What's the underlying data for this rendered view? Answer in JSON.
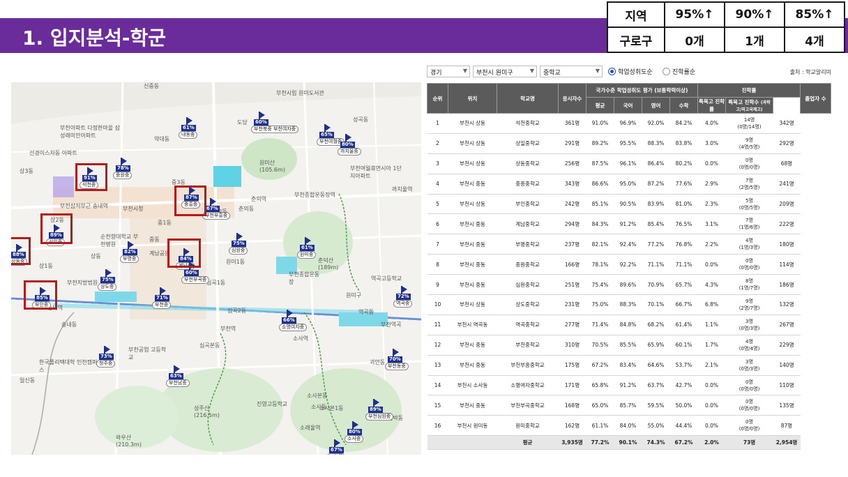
{
  "header": {
    "title": "1. 입지분석-학군"
  },
  "summary": {
    "headers": [
      "지역",
      "95%↑",
      "90%↑",
      "85%↑"
    ],
    "row": [
      "구로구",
      "0개",
      "1개",
      "4개"
    ]
  },
  "filters": {
    "province": "경기",
    "district": "부천시 원미구",
    "level": "중학교",
    "radio_options": [
      "학업성취도순",
      "진학률순"
    ],
    "selected_radio": "학업성취도순",
    "source": "출처 : 학교알리미"
  },
  "table": {
    "headers": {
      "rank": "순위",
      "location": "위치",
      "school": "학교명",
      "applicants": "응시자수",
      "achievement_group": "국가수준 학업성취도 평가 (보통학력이상)",
      "avg": "평균",
      "korean": "국어",
      "english": "영어",
      "math": "수학",
      "advance_group": "진학률",
      "special_rate": "특목고 진학률",
      "special_count": "특목고 진학수",
      "special_count_sub": "(과학고/외고국제고)",
      "graduates": "졸업자 수"
    },
    "rows": [
      {
        "rank": "1",
        "location": "부천시 상동",
        "school": "석천중학교",
        "applicants": "361명",
        "avg": "91.0%",
        "korean": "96.9%",
        "english": "92.0%",
        "math": "84.2%",
        "special_rate": "4.0%",
        "special_count": "14명",
        "special_sub": "(0명/14명)",
        "graduates": "342명"
      },
      {
        "rank": "2",
        "location": "부천시 상동",
        "school": "상일중학교",
        "applicants": "291명",
        "avg": "89.2%",
        "korean": "95.5%",
        "english": "88.3%",
        "math": "83.8%",
        "special_rate": "3.0%",
        "special_count": "9명",
        "special_sub": "(4명/5명)",
        "graduates": "292명"
      },
      {
        "rank": "3",
        "location": "부천시 상동",
        "school": "상동중학교",
        "applicants": "256명",
        "avg": "87.5%",
        "korean": "96.1%",
        "english": "86.4%",
        "math": "80.2%",
        "special_rate": "0.0%",
        "special_count": "0명",
        "special_sub": "(0명/0명)",
        "graduates": "68명"
      },
      {
        "rank": "4",
        "location": "부천시 중동",
        "school": "중흥중학교",
        "applicants": "343명",
        "avg": "86.6%",
        "korean": "95.0%",
        "english": "87.2%",
        "math": "77.6%",
        "special_rate": "2.9%",
        "special_count": "7명",
        "special_sub": "(2명/5명)",
        "graduates": "241명"
      },
      {
        "rank": "5",
        "location": "부천시 상동",
        "school": "부인중학교",
        "applicants": "242명",
        "avg": "85.1%",
        "korean": "90.5%",
        "english": "83.9%",
        "math": "81.0%",
        "special_rate": "2.3%",
        "special_count": "5명",
        "special_sub": "(0명/5명)",
        "graduates": "209명"
      },
      {
        "rank": "6",
        "location": "부천시 중동",
        "school": "계남중학교",
        "applicants": "294명",
        "avg": "84.3%",
        "korean": "91.2%",
        "english": "85.4%",
        "math": "76.5%",
        "special_rate": "3.1%",
        "special_count": "7명",
        "special_sub": "(1명/6명)",
        "graduates": "222명"
      },
      {
        "rank": "7",
        "location": "부천시 중동",
        "school": "부명중학교",
        "applicants": "237명",
        "avg": "82.1%",
        "korean": "92.4%",
        "english": "77.2%",
        "math": "76.8%",
        "special_rate": "2.2%",
        "special_count": "4명",
        "special_sub": "(1명/3명)",
        "graduates": "180명"
      },
      {
        "rank": "8",
        "location": "부천시 중동",
        "school": "중원중학교",
        "applicants": "166명",
        "avg": "78.1%",
        "korean": "92.2%",
        "english": "71.1%",
        "math": "71.1%",
        "special_rate": "0.0%",
        "special_count": "0명",
        "special_sub": "(0명/0명)",
        "graduates": "114명"
      },
      {
        "rank": "9",
        "location": "부천시 중동",
        "school": "심원중학교",
        "applicants": "251명",
        "avg": "75.4%",
        "korean": "89.6%",
        "english": "70.9%",
        "math": "65.7%",
        "special_rate": "4.3%",
        "special_count": "8명",
        "special_sub": "(1명/7명)",
        "graduates": "186명"
      },
      {
        "rank": "10",
        "location": "부천시 상동",
        "school": "상도중학교",
        "applicants": "231명",
        "avg": "75.0%",
        "korean": "88.3%",
        "english": "70.1%",
        "math": "66.7%",
        "special_rate": "6.8%",
        "special_count": "9명",
        "special_sub": "(2명/7명)",
        "graduates": "132명"
      },
      {
        "rank": "11",
        "location": "부천시 역곡동",
        "school": "역곡중학교",
        "applicants": "277명",
        "avg": "71.4%",
        "korean": "84.8%",
        "english": "68.2%",
        "math": "61.4%",
        "special_rate": "1.1%",
        "special_count": "3명",
        "special_sub": "(0명/3명)",
        "graduates": "267명"
      },
      {
        "rank": "12",
        "location": "부천시 중동",
        "school": "부천중학교",
        "applicants": "310명",
        "avg": "70.5%",
        "korean": "85.5%",
        "english": "65.9%",
        "math": "60.1%",
        "special_rate": "1.7%",
        "special_count": "4명",
        "special_sub": "(0명/4명)",
        "graduates": "229명"
      },
      {
        "rank": "13",
        "location": "부천시 중동",
        "school": "부천부흥중학교",
        "applicants": "175명",
        "avg": "67.2%",
        "korean": "83.4%",
        "english": "64.6%",
        "math": "53.7%",
        "special_rate": "2.1%",
        "special_count": "3명",
        "special_sub": "(0명/3명)",
        "graduates": "140명"
      },
      {
        "rank": "14",
        "location": "부천시 소사동",
        "school": "소명여자중학교",
        "applicants": "171명",
        "avg": "65.8%",
        "korean": "91.2%",
        "english": "63.7%",
        "math": "42.7%",
        "special_rate": "0.0%",
        "special_count": "0명",
        "special_sub": "(0명/0명)",
        "graduates": "110명"
      },
      {
        "rank": "15",
        "location": "부천시 중동",
        "school": "부천부곡중학교",
        "applicants": "168명",
        "avg": "65.0%",
        "korean": "85.7%",
        "english": "59.5%",
        "math": "50.0%",
        "special_rate": "0.0%",
        "special_count": "0명",
        "special_sub": "(0명/0명)",
        "graduates": "135명"
      },
      {
        "rank": "16",
        "location": "부천시 원미동",
        "school": "원미중학교",
        "applicants": "162명",
        "avg": "61.1%",
        "korean": "84.0%",
        "english": "55.0%",
        "math": "44.4%",
        "special_rate": "0.0%",
        "special_count": "0명",
        "special_sub": "(0명/0명)",
        "graduates": "87명"
      }
    ],
    "average_row": {
      "label": "평균",
      "applicants": "3,935명",
      "avg": "77.2%",
      "korean": "90.1%",
      "english": "74.3%",
      "math": "67.2%",
      "special_rate": "2.0%",
      "special_count": "73명",
      "graduates": "2,954명"
    }
  },
  "map": {
    "places": [
      "신중동",
      "성곡동",
      "약대동",
      "도당",
      "부천시립 원미도서관",
      "부천아파트 다정한마을 삼성래미안아파트",
      "선경이스자동 아파트",
      "상3동",
      "상동",
      "부천삼저부근 송내역",
      "상2동",
      "상1동",
      "중동",
      "중3동",
      "중2동",
      "중1동",
      "춘의동",
      "춘의역",
      "원미산 (105.6m)",
      "부천역",
      "부천시청",
      "순천향대학교 부천병원",
      "계남공원",
      "원미1동",
      "심곡1동",
      "심곡2동",
      "심곡본동",
      "소사역",
      "소사동",
      "소사본동",
      "소사본1동",
      "송내동",
      "일신동",
      "원미구",
      "역곡동",
      "괴안동",
      "부천공업 고등학교",
      "성주산 (216.5m)",
      "와우산 (210.3m)",
      "소래울역",
      "범박동",
      "진영고등학교",
      "한국폴리텍대학 인천캠퍼스",
      "까치울역",
      "부천종합운동장역",
      "부천여월휴먼시아 1단지아파트",
      "부천지방법원",
      "역곡고등학교",
      "춘덕산 (189m)",
      "부천종합운동장",
      "송내역",
      "부천역곡"
    ],
    "pins": [
      {
        "pct": "61%",
        "name": "내동중"
      },
      {
        "pct": "60%",
        "name": "부천북중 부천여자중"
      },
      {
        "pct": "65%",
        "name": "부천여월중"
      },
      {
        "pct": "80%",
        "name": "까치울중"
      },
      {
        "pct": "78%",
        "name": "중원중"
      },
      {
        "pct": "91%",
        "name": "석천중"
      },
      {
        "pct": "87%",
        "name": "중흥중"
      },
      {
        "pct": "67%",
        "name": "부천부흥중"
      },
      {
        "pct": "89%",
        "name": "상일중"
      },
      {
        "pct": "82%",
        "name": "부명중"
      },
      {
        "pct": "88%",
        "name": "상동중"
      },
      {
        "pct": "84%",
        "name": "계남중"
      },
      {
        "pct": "60%",
        "name": "부천부곡중"
      },
      {
        "pct": "75%",
        "name": "심원중"
      },
      {
        "pct": "61%",
        "name": "원미중"
      },
      {
        "pct": "75%",
        "name": "상도중"
      },
      {
        "pct": "71%",
        "name": "부천중"
      },
      {
        "pct": "85%",
        "name": "부인중"
      },
      {
        "pct": "66%",
        "name": "소명여자중"
      },
      {
        "pct": "72%",
        "name": "역곡중"
      },
      {
        "pct": "73%",
        "name": "청주중"
      },
      {
        "pct": "63%",
        "name": "부천남중"
      },
      {
        "pct": "70%",
        "name": "부천동중"
      },
      {
        "pct": "89%",
        "name": "부천심원중"
      },
      {
        "pct": "80%",
        "name": "소사중"
      },
      {
        "pct": "67%",
        "name": "부일중"
      }
    ]
  },
  "colors": {
    "header_bg": "#6a2c9a",
    "pin": "#1d2f8f",
    "highlight": "#b21c1c",
    "table_header": "#5b5b5b"
  }
}
